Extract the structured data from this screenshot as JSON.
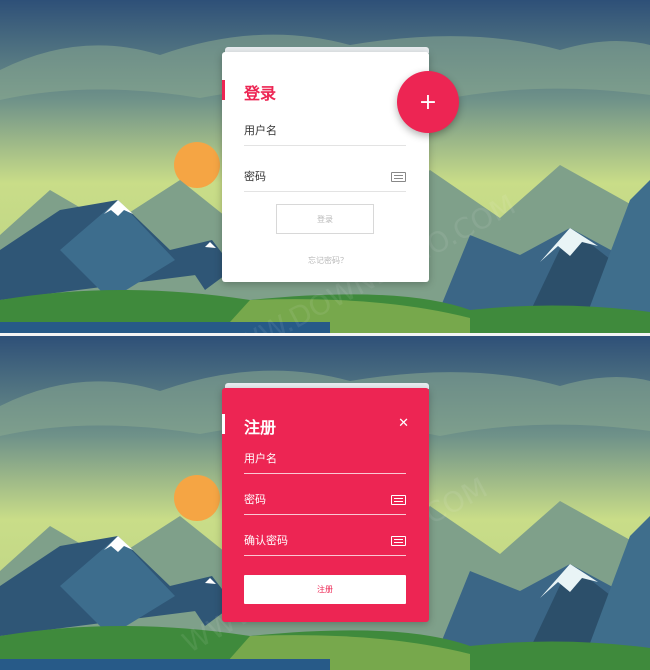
{
  "login": {
    "title": "登录",
    "username_label": "用户名",
    "password_label": "密码",
    "submit_label": "登录",
    "forgot_label": "忘记密码？",
    "fab_label": "+"
  },
  "register": {
    "title": "注册",
    "close_label": "✕",
    "username_label": "用户名",
    "password_label": "密码",
    "confirm_label": "确认密码",
    "submit_label": "注册"
  },
  "watermark": "WWW.DOWNDEMO.COM",
  "colors": {
    "accent": "#ed2553",
    "card": "#ffffff",
    "sky_top": "#2e5078",
    "sky_glow": "#c9dd88",
    "mountain": "#3a6684",
    "grass": "#3f8a3c",
    "sun": "#f5a544"
  },
  "icons": [
    "keyboard-icon",
    "plus-icon",
    "close-icon"
  ]
}
